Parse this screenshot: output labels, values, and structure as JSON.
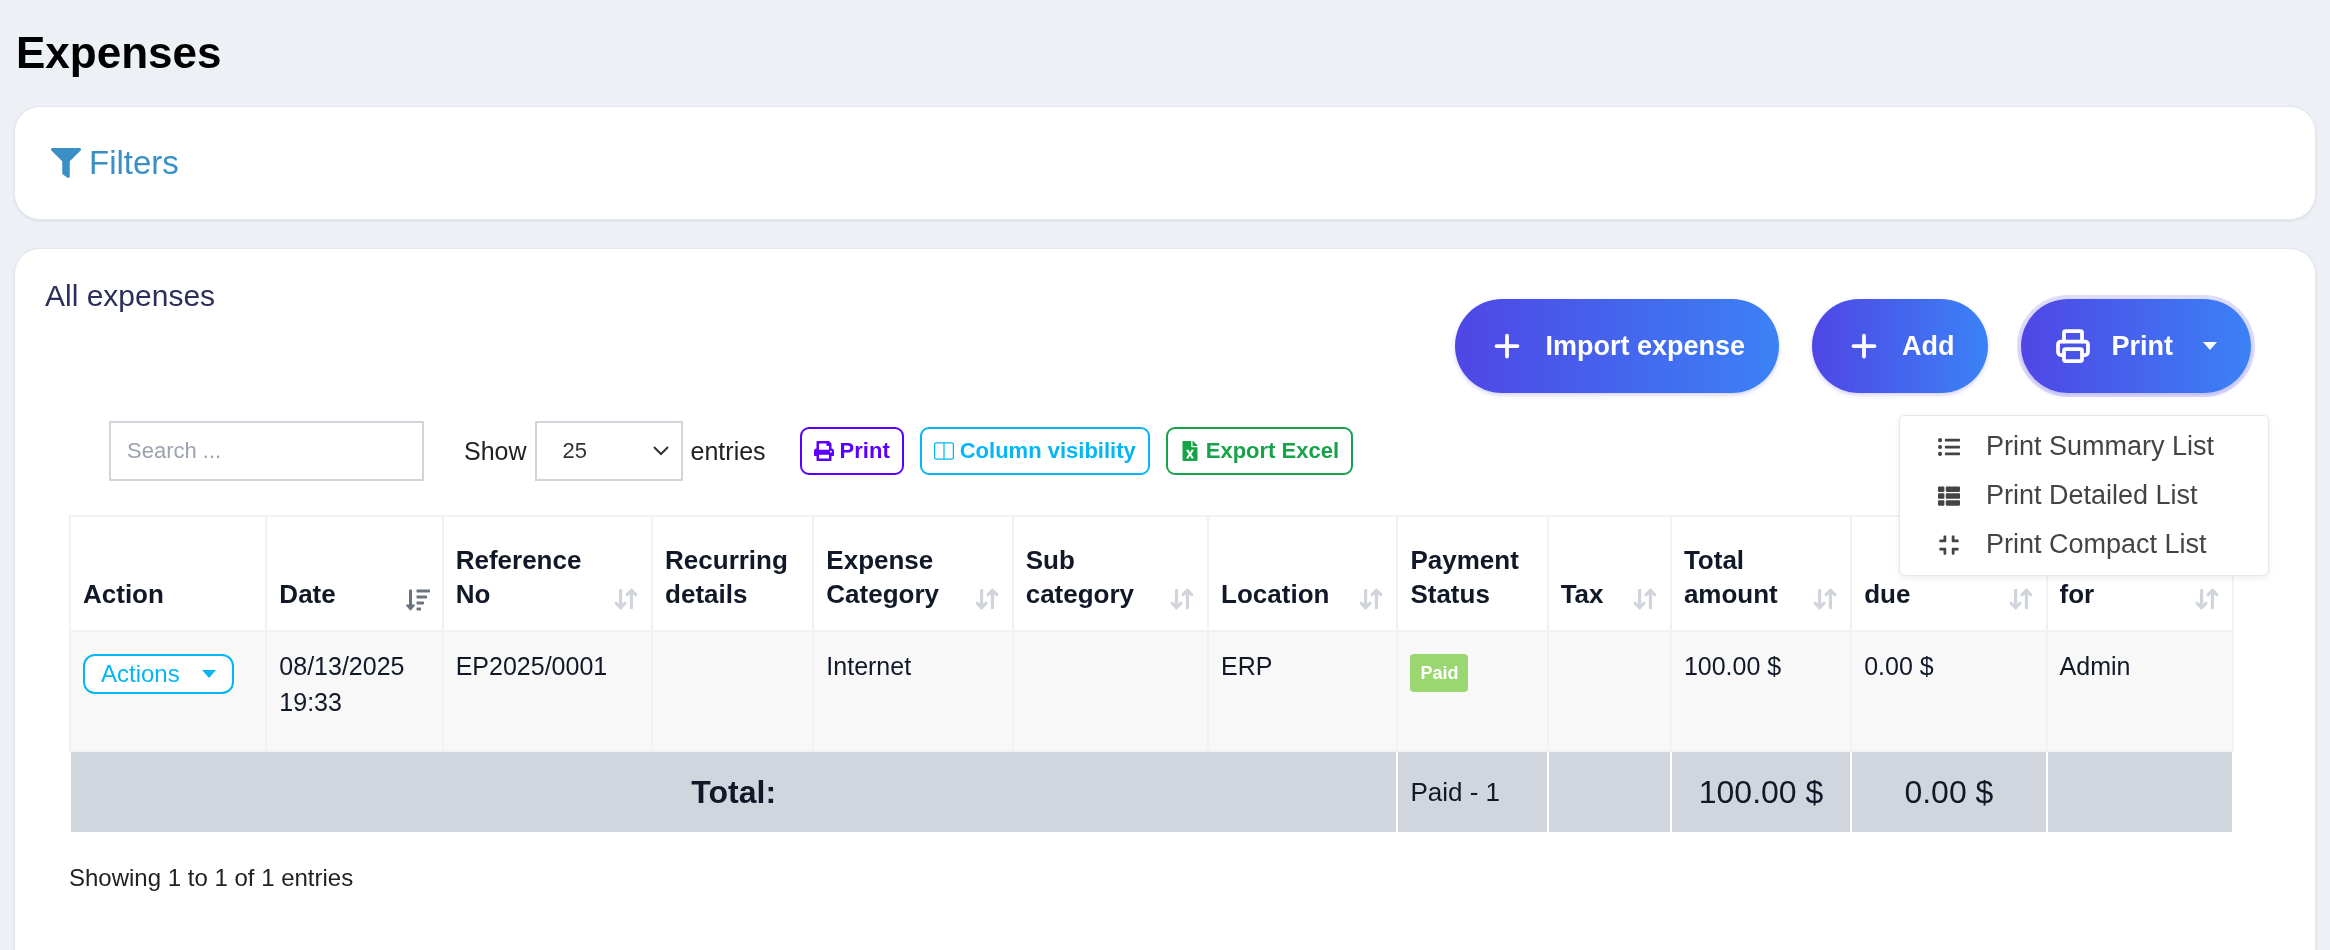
{
  "page_title": "Expenses",
  "filters": {
    "label": "Filters"
  },
  "card": {
    "title": "All expenses",
    "actions": [
      {
        "kind": "import",
        "label": "Import expense"
      },
      {
        "kind": "add",
        "label": "Add"
      },
      {
        "kind": "print",
        "label": "Print",
        "expanded": true
      }
    ],
    "print_menu": [
      {
        "kind": "summary",
        "label": "Print Summary List"
      },
      {
        "kind": "detailed",
        "label": "Print Detailed List"
      },
      {
        "kind": "compact",
        "label": "Print Compact List"
      }
    ],
    "search": {
      "placeholder": "Search ..."
    },
    "length": {
      "prefix": "Show",
      "value": "25",
      "suffix": "entries"
    },
    "tools": [
      {
        "kind": "print",
        "label": "Print"
      },
      {
        "kind": "columns",
        "label": "Column visibility"
      },
      {
        "kind": "excel",
        "label": "Export Excel"
      }
    ],
    "table": {
      "columns": [
        {
          "label": "Action",
          "sortable": false
        },
        {
          "label": "Date",
          "sortable": true,
          "sorted": true
        },
        {
          "label": "Reference No",
          "sortable": true,
          "sorted": false
        },
        {
          "label": "Recurring details",
          "sortable": false
        },
        {
          "label": "Expense Category",
          "sortable": true,
          "sorted": false
        },
        {
          "label": "Sub category",
          "sortable": true,
          "sorted": false
        },
        {
          "label": "Location",
          "sortable": true,
          "sorted": false
        },
        {
          "label": "Payment Status",
          "sortable": false
        },
        {
          "label": "Tax",
          "sortable": true,
          "sorted": false
        },
        {
          "label": "Total amount",
          "sortable": true,
          "sorted": false
        },
        {
          "label": "due",
          "sortable": true,
          "sorted": false
        },
        {
          "label": "for",
          "sortable": true,
          "sorted": false
        }
      ],
      "rows": [
        {
          "action": "Actions",
          "date": "08/13/2025 19:33",
          "reference": "EP2025/0001",
          "category": "Internet",
          "location": "ERP",
          "status": {
            "label": "Paid",
            "color": "#9bd770"
          },
          "total": "100.00 $",
          "due": "0.00 $",
          "expense_for": "Admin"
        }
      ],
      "footer": {
        "label": "Total:",
        "status": "Paid - 1",
        "total": "100.00 $",
        "due": "0.00 $"
      }
    },
    "info": "Showing 1 to 1 of 1 entries"
  }
}
